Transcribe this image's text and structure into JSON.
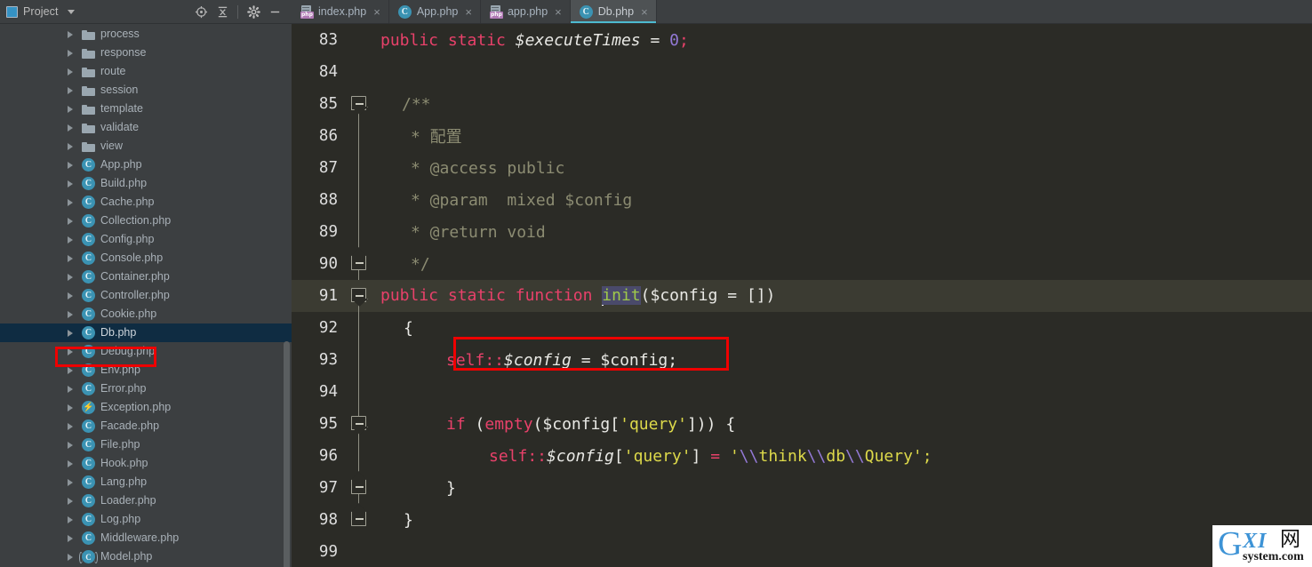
{
  "project_panel": {
    "title": "Project",
    "icon": "project-icon",
    "tools": [
      {
        "name": "locate-target-icon",
        "label": "Select Opened File"
      },
      {
        "name": "collapse-all-icon",
        "label": "Collapse All"
      },
      {
        "name": "gear-icon",
        "label": "Settings"
      },
      {
        "name": "minimize-icon",
        "label": "Hide"
      }
    ],
    "tree": [
      {
        "label": "process",
        "type": "folder"
      },
      {
        "label": "response",
        "type": "folder"
      },
      {
        "label": "route",
        "type": "folder"
      },
      {
        "label": "session",
        "type": "folder"
      },
      {
        "label": "template",
        "type": "folder"
      },
      {
        "label": "validate",
        "type": "folder"
      },
      {
        "label": "view",
        "type": "folder"
      },
      {
        "label": "App.php",
        "type": "class"
      },
      {
        "label": "Build.php",
        "type": "class"
      },
      {
        "label": "Cache.php",
        "type": "class"
      },
      {
        "label": "Collection.php",
        "type": "class"
      },
      {
        "label": "Config.php",
        "type": "class"
      },
      {
        "label": "Console.php",
        "type": "class"
      },
      {
        "label": "Container.php",
        "type": "class"
      },
      {
        "label": "Controller.php",
        "type": "class"
      },
      {
        "label": "Cookie.php",
        "type": "class"
      },
      {
        "label": "Db.php",
        "type": "class",
        "selected": true,
        "annotated": true
      },
      {
        "label": "Debug.php",
        "type": "class"
      },
      {
        "label": "Env.php",
        "type": "class"
      },
      {
        "label": "Error.php",
        "type": "class"
      },
      {
        "label": "Exception.php",
        "type": "exception"
      },
      {
        "label": "Facade.php",
        "type": "class"
      },
      {
        "label": "File.php",
        "type": "class"
      },
      {
        "label": "Hook.php",
        "type": "class"
      },
      {
        "label": "Lang.php",
        "type": "class"
      },
      {
        "label": "Loader.php",
        "type": "class"
      },
      {
        "label": "Log.php",
        "type": "class"
      },
      {
        "label": "Middleware.php",
        "type": "class"
      },
      {
        "label": "Model.php",
        "type": "model"
      }
    ]
  },
  "tabs": [
    {
      "label": "index.php",
      "type": "php",
      "active": false
    },
    {
      "label": "App.php",
      "type": "class",
      "active": false
    },
    {
      "label": "app.php",
      "type": "php",
      "active": false
    },
    {
      "label": "Db.php",
      "type": "class",
      "active": true
    }
  ],
  "tab_close_glyph": "×",
  "editor": {
    "lines": [
      {
        "num": "83",
        "fold": "none",
        "current": false
      },
      {
        "num": "84",
        "fold": "none",
        "current": false
      },
      {
        "num": "85",
        "fold": "start",
        "current": false
      },
      {
        "num": "86",
        "fold": "mid",
        "current": false
      },
      {
        "num": "87",
        "fold": "mid",
        "current": false
      },
      {
        "num": "88",
        "fold": "mid",
        "current": false
      },
      {
        "num": "89",
        "fold": "mid",
        "current": false
      },
      {
        "num": "90",
        "fold": "end",
        "current": false
      },
      {
        "num": "91",
        "fold": "start",
        "current": true
      },
      {
        "num": "92",
        "fold": "mid",
        "current": false
      },
      {
        "num": "93",
        "fold": "mid",
        "current": false
      },
      {
        "num": "94",
        "fold": "mid",
        "current": false
      },
      {
        "num": "95",
        "fold": "start",
        "current": false
      },
      {
        "num": "96",
        "fold": "mid",
        "current": false
      },
      {
        "num": "97",
        "fold": "end",
        "current": false
      },
      {
        "num": "98",
        "fold": "end",
        "current": false
      },
      {
        "num": "99",
        "fold": "none",
        "current": false
      }
    ],
    "code": {
      "l83_kw1": "public",
      "l83_kw2": "static",
      "l83_var": "$executeTimes",
      "l83_eq": "=",
      "l83_num": "0",
      "l83_semi": ";",
      "l85": "/**",
      "l86": "* 配置",
      "l87": "* @access public",
      "l88": "* @param  mixed $config",
      "l89": "* @return void",
      "l90": "*/",
      "l91_kw1": "public",
      "l91_kw2": "static",
      "l91_kw3": "function",
      "l91_fn": "init",
      "l91_rest": "($config = [])",
      "l92": "{",
      "l93_self": "self::",
      "l93_var": "$config",
      "l93_eq": " = ",
      "l93_val": "$config;",
      "l95_if": "if",
      "l95_p1": " (",
      "l95_empty": "empty",
      "l95_p2": "($config[",
      "l95_str": "'query'",
      "l95_p3": "])) {",
      "l96_self": "self::",
      "l96_var": "$config",
      "l96_idx1": "[",
      "l96_key": "'query'",
      "l96_idx2": "]",
      "l96_eq": " = ",
      "l96_q1": "'",
      "l96_e1": "\\\\",
      "l96_t1": "think",
      "l96_e2": "\\\\",
      "l96_t2": "db",
      "l96_e3": "\\\\",
      "l96_t3": "Query",
      "l96_q2": "';",
      "l97": "}",
      "l98": "}"
    }
  },
  "watermark": {
    "letter": "G",
    "xi": "XI",
    "cn": "网",
    "domain": "system.com"
  },
  "colors": {
    "keyword": "#e8416a",
    "function": "#9fc94a",
    "string": "#ddd94a",
    "number": "#9379d6",
    "comment": "#8c8c72",
    "editor_bg": "#2b2b26",
    "panel_bg": "#3c3f41",
    "selection": "#0f2c42",
    "annotation": "#ef0000",
    "tab_accent": "#4dbbd0"
  }
}
